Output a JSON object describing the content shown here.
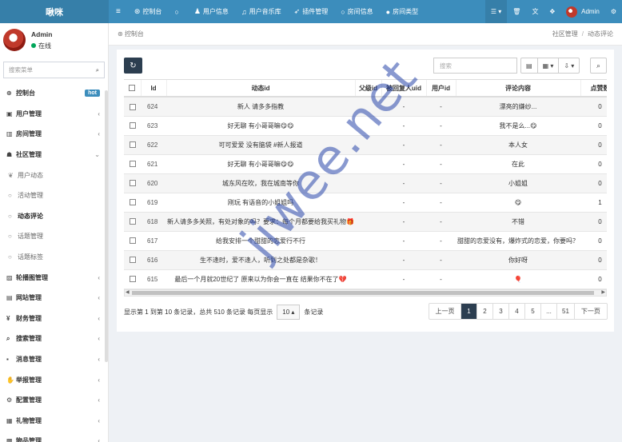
{
  "app": {
    "brand": "啾咪"
  },
  "topnav": {
    "items": [
      {
        "label": "控制台",
        "icon": "dashboard-icon",
        "glyph": "⊛"
      },
      {
        "label": "",
        "icon": "circle-icon",
        "glyph": "○"
      },
      {
        "label": "用户信息",
        "icon": "user-icon",
        "glyph": "♟"
      },
      {
        "label": "用户音乐库",
        "icon": "music-icon",
        "glyph": "♫"
      },
      {
        "label": "插件管理",
        "icon": "rocket-icon",
        "glyph": "➶"
      },
      {
        "label": "房间信息",
        "icon": "circle-icon",
        "glyph": "○"
      },
      {
        "label": "房间类型",
        "icon": "circle-filled-icon",
        "glyph": "●"
      }
    ],
    "user_name": "Admin"
  },
  "sidebar": {
    "user_name": "Admin",
    "status": "在线",
    "search_placeholder": "搜索菜单",
    "items": [
      {
        "label": "控制台",
        "icon": "dashboard-icon",
        "glyph": "⊛",
        "badge": "hot",
        "type": "top"
      },
      {
        "label": "用户管理",
        "icon": "user-icon",
        "glyph": "▣",
        "type": "top",
        "chev": "‹"
      },
      {
        "label": "房间管理",
        "icon": "building-icon",
        "glyph": "▥",
        "type": "top",
        "chev": "‹"
      },
      {
        "label": "社区管理",
        "icon": "group-icon",
        "glyph": "☗",
        "type": "top",
        "chev": "⌄"
      },
      {
        "label": "用户动态",
        "icon": "leaf-icon",
        "glyph": "❦",
        "type": "sub"
      },
      {
        "label": "活动管理",
        "icon": "circle-icon",
        "glyph": "○",
        "type": "sub"
      },
      {
        "label": "动态评论",
        "icon": "circle-icon",
        "glyph": "○",
        "type": "sub",
        "current": true
      },
      {
        "label": "话题管理",
        "icon": "circle-icon",
        "glyph": "○",
        "type": "sub"
      },
      {
        "label": "话题标签",
        "icon": "circle-icon",
        "glyph": "○",
        "type": "sub"
      },
      {
        "label": "轮播图管理",
        "icon": "image-icon",
        "glyph": "▨",
        "type": "top",
        "chev": "‹"
      },
      {
        "label": "网站管理",
        "icon": "globe-icon",
        "glyph": "▤",
        "type": "top",
        "chev": "‹"
      },
      {
        "label": "财务管理",
        "icon": "money-icon",
        "glyph": "¥",
        "type": "top",
        "chev": "‹"
      },
      {
        "label": "搜索管理",
        "icon": "search-icon",
        "glyph": "⌕",
        "type": "top",
        "chev": "‹"
      },
      {
        "label": "消息管理",
        "icon": "message-icon",
        "glyph": "▪",
        "type": "top",
        "chev": "‹"
      },
      {
        "label": "举报管理",
        "icon": "hand-icon",
        "glyph": "✋",
        "type": "top",
        "chev": "‹"
      },
      {
        "label": "配置管理",
        "icon": "cogs-icon",
        "glyph": "⚙",
        "type": "top",
        "chev": "‹"
      },
      {
        "label": "礼物管理",
        "icon": "gift-icon",
        "glyph": "▦",
        "type": "top",
        "chev": "‹"
      },
      {
        "label": "物品管理",
        "icon": "box-icon",
        "glyph": "▩",
        "type": "top",
        "chev": "‹"
      }
    ]
  },
  "breadcrumb": {
    "left": "控制台",
    "right": [
      "社区管理",
      "动态评论"
    ]
  },
  "toolbar": {
    "search_placeholder": "搜索"
  },
  "table": {
    "columns": [
      "",
      "Id",
      "动态id",
      "父级id",
      "被回复人uid",
      "用户id",
      "评论内容",
      "点赞数"
    ],
    "rows": [
      {
        "id": "624",
        "dyn": "新人 请多多指教",
        "parent": "",
        "reply": "-",
        "uid": "-",
        "content": "漂亮的嫌纱...",
        "likes": "0"
      },
      {
        "id": "623",
        "dyn": "好无聊 有小哥哥嘛😋😋",
        "parent": "",
        "reply": "-",
        "uid": "-",
        "content": "我不是么...😋",
        "likes": "0"
      },
      {
        "id": "622",
        "dyn": "可可爱爱 没有脑袋 #新人报道",
        "parent": "",
        "reply": "-",
        "uid": "-",
        "content": "本人女",
        "likes": "0"
      },
      {
        "id": "621",
        "dyn": "好无聊 有小哥哥嘛😋😋",
        "parent": "",
        "reply": "-",
        "uid": "-",
        "content": "在此",
        "likes": "0"
      },
      {
        "id": "620",
        "dyn": "城东风在吹，我在城南等你",
        "parent": "",
        "reply": "-",
        "uid": "-",
        "content": "小姐姐",
        "likes": "0"
      },
      {
        "id": "619",
        "dyn": "刚玩 有语音的小姐姐吗",
        "parent": "",
        "reply": "-",
        "uid": "-",
        "content": "😋",
        "likes": "1"
      },
      {
        "id": "618",
        "dyn": "新人请多多关照，有处对象的吗？要求：每个月都要给我买礼物🎁",
        "parent": "",
        "reply": "-",
        "uid": "-",
        "content": "不错",
        "likes": "0"
      },
      {
        "id": "617",
        "dyn": "给我安排一个甜甜的恋爱行不行",
        "parent": "",
        "reply": "-",
        "uid": "-",
        "content": "甜甜的恋爱没有，爆炸式的恋爱，你要吗？",
        "likes": "0"
      },
      {
        "id": "616",
        "dyn": "生不逢时，爱不逢人，听到之处都是杂歌！",
        "parent": "",
        "reply": "-",
        "uid": "-",
        "content": "你好呀",
        "likes": "0"
      },
      {
        "id": "615",
        "dyn": "最后一个月就20世纪了 原来以为你会一直在 结果你不在了💔",
        "parent": "",
        "reply": "-",
        "uid": "-",
        "content": "🎈",
        "likes": "0"
      }
    ]
  },
  "pager": {
    "info_prefix": "显示第 1 到第 10 条记录，总共 510 条记录 每页显示",
    "page_size": "10",
    "info_suffix": "条记录",
    "prev": "上一页",
    "pages": [
      "1",
      "2",
      "3",
      "4",
      "5",
      "...",
      "51"
    ],
    "active_page": "1",
    "next": "下一页"
  },
  "watermark": "jiwee.net"
}
